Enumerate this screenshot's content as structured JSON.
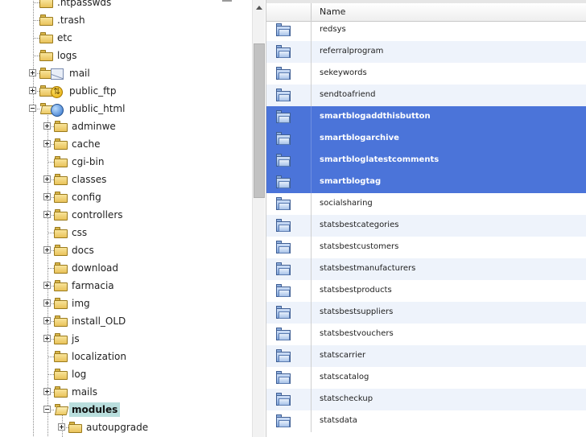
{
  "tree": {
    "items": [
      {
        "label": ".htpasswds",
        "depth": 1,
        "expander": false,
        "overlay": "",
        "open": false,
        "selected": false
      },
      {
        "label": ".trash",
        "depth": 1,
        "expander": false,
        "overlay": "",
        "open": false,
        "selected": false
      },
      {
        "label": "etc",
        "depth": 1,
        "expander": false,
        "overlay": "",
        "open": false,
        "selected": false
      },
      {
        "label": "logs",
        "depth": 1,
        "expander": false,
        "overlay": "",
        "open": false,
        "selected": false
      },
      {
        "label": "mail",
        "depth": 1,
        "expander": "plus",
        "overlay": "mail",
        "open": false,
        "selected": false
      },
      {
        "label": "public_ftp",
        "depth": 1,
        "expander": "plus",
        "overlay": "ftp",
        "open": false,
        "selected": false
      },
      {
        "label": "public_html",
        "depth": 1,
        "expander": "minus",
        "overlay": "globe",
        "open": true,
        "selected": false
      },
      {
        "label": "adminwe",
        "depth": 2,
        "expander": "plus",
        "overlay": "",
        "open": false,
        "selected": false
      },
      {
        "label": "cache",
        "depth": 2,
        "expander": "plus",
        "overlay": "",
        "open": false,
        "selected": false
      },
      {
        "label": "cgi-bin",
        "depth": 2,
        "expander": false,
        "overlay": "",
        "open": false,
        "selected": false
      },
      {
        "label": "classes",
        "depth": 2,
        "expander": "plus",
        "overlay": "",
        "open": false,
        "selected": false
      },
      {
        "label": "config",
        "depth": 2,
        "expander": "plus",
        "overlay": "",
        "open": false,
        "selected": false
      },
      {
        "label": "controllers",
        "depth": 2,
        "expander": "plus",
        "overlay": "",
        "open": false,
        "selected": false
      },
      {
        "label": "css",
        "depth": 2,
        "expander": false,
        "overlay": "",
        "open": false,
        "selected": false
      },
      {
        "label": "docs",
        "depth": 2,
        "expander": "plus",
        "overlay": "",
        "open": false,
        "selected": false
      },
      {
        "label": "download",
        "depth": 2,
        "expander": false,
        "overlay": "",
        "open": false,
        "selected": false
      },
      {
        "label": "farmacia",
        "depth": 2,
        "expander": "plus",
        "overlay": "",
        "open": false,
        "selected": false
      },
      {
        "label": "img",
        "depth": 2,
        "expander": "plus",
        "overlay": "",
        "open": false,
        "selected": false
      },
      {
        "label": "install_OLD",
        "depth": 2,
        "expander": "plus",
        "overlay": "",
        "open": false,
        "selected": false
      },
      {
        "label": "js",
        "depth": 2,
        "expander": "plus",
        "overlay": "",
        "open": false,
        "selected": false
      },
      {
        "label": "localization",
        "depth": 2,
        "expander": false,
        "overlay": "",
        "open": false,
        "selected": false
      },
      {
        "label": "log",
        "depth": 2,
        "expander": false,
        "overlay": "",
        "open": false,
        "selected": false
      },
      {
        "label": "mails",
        "depth": 2,
        "expander": "plus",
        "overlay": "",
        "open": false,
        "selected": false
      },
      {
        "label": "modules",
        "depth": 2,
        "expander": "minus",
        "overlay": "",
        "open": true,
        "selected": true
      },
      {
        "label": "autoupgrade",
        "depth": 3,
        "expander": "plus",
        "overlay": "",
        "open": false,
        "selected": false
      }
    ]
  },
  "list": {
    "header_name": "Name",
    "rows": [
      {
        "name": "redsys",
        "selected": false
      },
      {
        "name": "referralprogram",
        "selected": false
      },
      {
        "name": "sekeywords",
        "selected": false
      },
      {
        "name": "sendtoafriend",
        "selected": false
      },
      {
        "name": "smartblogaddthisbutton",
        "selected": true
      },
      {
        "name": "smartblogarchive",
        "selected": true
      },
      {
        "name": "smartbloglatestcomments",
        "selected": true
      },
      {
        "name": "smartblogtag",
        "selected": true
      },
      {
        "name": "socialsharing",
        "selected": false
      },
      {
        "name": "statsbestcategories",
        "selected": false
      },
      {
        "name": "statsbestcustomers",
        "selected": false
      },
      {
        "name": "statsbestmanufacturers",
        "selected": false
      },
      {
        "name": "statsbestproducts",
        "selected": false
      },
      {
        "name": "statsbestsuppliers",
        "selected": false
      },
      {
        "name": "statsbestvouchers",
        "selected": false
      },
      {
        "name": "statscarrier",
        "selected": false
      },
      {
        "name": "statscatalog",
        "selected": false
      },
      {
        "name": "statscheckup",
        "selected": false
      },
      {
        "name": "statsdata",
        "selected": false
      }
    ]
  },
  "colors": {
    "selection": "#4b74d9",
    "tree_selection": "#b9dedd",
    "alt_row": "#eef3fb"
  }
}
